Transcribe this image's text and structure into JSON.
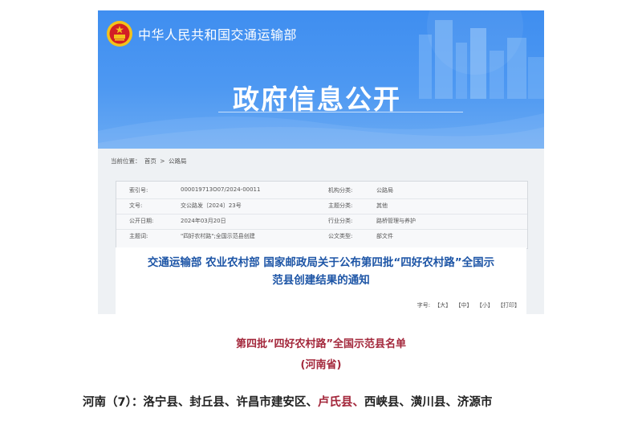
{
  "banner": {
    "ministry": "中华人民共和国交通运输部",
    "portal_title": "政府信息公开",
    "colors": {
      "banner": "#4d98f2",
      "emblem_red": "#d21f26",
      "emblem_gold": "#f3c21b"
    },
    "icons": [
      "national-emblem-icon",
      "city-skyline-graphic"
    ]
  },
  "breadcrumb": {
    "label": "当前位置：",
    "items": [
      "首页",
      "公路局"
    ],
    "separator": ">"
  },
  "meta": {
    "rows": [
      {
        "k1": "索引号:",
        "v1": "000019713O07/2024-00011",
        "k2": "机构分类:",
        "v2": "公路局"
      },
      {
        "k1": "文号:",
        "v1": "交公路发〔2024〕23号",
        "k2": "主题分类:",
        "v2": "其他"
      },
      {
        "k1": "公开日期:",
        "v1": "2024年03月20日",
        "k2": "行业分类:",
        "v2": "路桥管理与养护"
      },
      {
        "k1": "主题词:",
        "v1": "\"四好农村路\";全国示范县创建",
        "k2": "公文类型:",
        "v2": "部文件"
      }
    ]
  },
  "document": {
    "title_line1": "交通运输部 农业农村部 国家邮政局关于公布第四批“四好农村路”全国示",
    "title_line2": "范县创建结果的通知",
    "font_label": "字号:",
    "font_large": "【大】",
    "font_medium": "【中】",
    "font_small": "【小】",
    "print": "【打印】"
  },
  "list": {
    "title": "第四批“四好农村路”全国示范县名单",
    "province": "(河南省)",
    "prefix": "河南（7）：",
    "counties_before": "洛宁县、封丘县、许昌市建安区、",
    "highlight": "卢氏县、",
    "counties_after": "西峡县、潢川县、济源市",
    "highlight_color": "#a3273b"
  }
}
